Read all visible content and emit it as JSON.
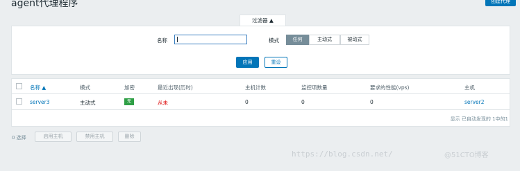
{
  "header": {
    "title": "agent代理程序",
    "create_button": "创建代理"
  },
  "filter": {
    "tab_label": "过滤器 ▲",
    "name_label": "名称",
    "name_value": "",
    "mode_label": "模式",
    "mode_options": [
      "任何",
      "主动式",
      "被动式"
    ],
    "selected_mode": "任何",
    "apply": "应用",
    "reset": "重设"
  },
  "table": {
    "headers": [
      "名称 ▲",
      "模式",
      "加密",
      "最近出现(历时)",
      "主机计数",
      "监控项数量",
      "要求的性能(vps)",
      "主机"
    ],
    "rows": [
      {
        "name": "server3",
        "mode": "主动式",
        "encryption": "无",
        "last_seen": "从未",
        "host_count": "0",
        "items": "0",
        "vps": "0",
        "hosts": "server2"
      }
    ],
    "footer": "显示 已自动发现的 1中的1"
  },
  "bulk": {
    "selected": "0 选择",
    "buttons": [
      "启用主机",
      "禁用主机",
      "删除"
    ]
  },
  "watermark": {
    "url": "https://blog.csdn.net/",
    "brand": "@51CTO博客"
  },
  "colors": {
    "accent": "#0275b8",
    "active_segment": "#768d99",
    "badge_green": "#2f9f46",
    "never_red": "#dc0000"
  }
}
